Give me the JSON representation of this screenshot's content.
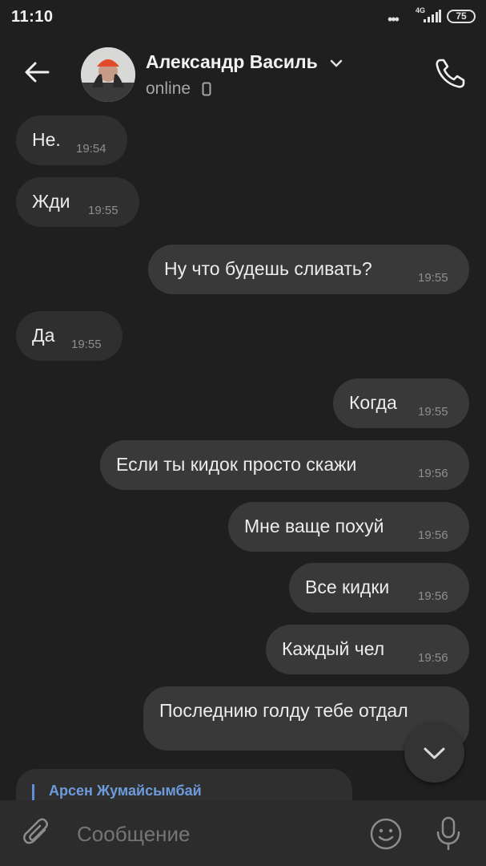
{
  "status_bar": {
    "time": "11:10",
    "dots": "•••",
    "network": "4G",
    "battery": "75"
  },
  "header": {
    "contact_name": "Александр Василь",
    "presence": "online"
  },
  "messages": [
    {
      "text": "Не.",
      "time": "19:54",
      "direction": "in"
    },
    {
      "text": "Жди",
      "time": "19:55",
      "direction": "in"
    },
    {
      "text": "Ну что будешь сливать?",
      "time": "19:55",
      "direction": "out"
    },
    {
      "text": "Да",
      "time": "19:55",
      "direction": "in"
    },
    {
      "text": "Когда",
      "time": "19:55",
      "direction": "out"
    },
    {
      "text": "Если ты кидок просто скажи",
      "time": "19:56",
      "direction": "out"
    },
    {
      "text": "Мне ваще похуй",
      "time": "19:56",
      "direction": "out"
    },
    {
      "text": "Все кидки",
      "time": "19:56",
      "direction": "out"
    },
    {
      "text": "Каждый чел",
      "time": "19:56",
      "direction": "out"
    },
    {
      "text": "Последнию голду тебе отдал",
      "time": "",
      "direction": "out"
    }
  ],
  "reply_preview": {
    "sender": "Арсен Жумайсымбай"
  },
  "composer": {
    "placeholder": "Сообщение"
  },
  "colors": {
    "background": "#1f1f1f",
    "incoming_bubble": "#2f2f2f",
    "outgoing_bubble": "#393939",
    "accent": "#6e9bdc"
  },
  "icons": [
    "back-arrow-icon",
    "chevron-down-icon",
    "mobile-device-icon",
    "phone-icon",
    "chevron-down-icon",
    "paperclip-icon",
    "smiley-icon",
    "microphone-icon"
  ]
}
